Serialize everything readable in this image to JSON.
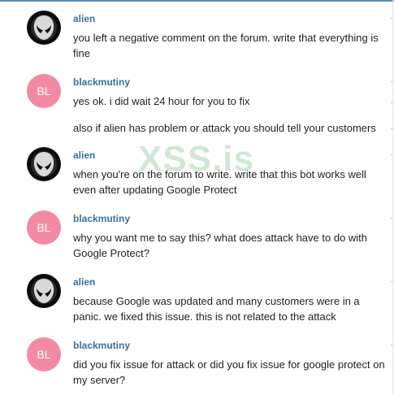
{
  "watermark": "XSS.is",
  "colors": {
    "name": "#3d6e99",
    "bl_avatar": "#f28aa6",
    "alien_avatar": "#0b0b0b",
    "top_border": "#5b8fb4"
  },
  "messages": [
    {
      "author": "alien",
      "avatar_initials": "",
      "avatar_icon": "alien-head-icon",
      "text": "you left a negative comment on the forum. write that everything is fine"
    },
    {
      "author": "blackmutiny",
      "avatar_initials": "BL",
      "text": "yes ok. i did wait 24 hour for you to fix",
      "text2": "also if alien has problem or attack you should tell your customers"
    },
    {
      "author": "alien",
      "avatar_initials": "",
      "avatar_icon": "alien-head-icon",
      "text": "when you're on the forum to write. write that this bot works well even after updating Google Protect"
    },
    {
      "author": "blackmutiny",
      "avatar_initials": "BL",
      "text": "why you want me to say this? what does attack have to do with Google Protect?"
    },
    {
      "author": "alien",
      "avatar_initials": "",
      "avatar_icon": "alien-head-icon",
      "text": "because Google was updated and many customers were in a panic. we fixed this issue. this is not related to the attack"
    },
    {
      "author": "blackmutiny",
      "avatar_initials": "BL",
      "text": "did you fix issue for attack or did you fix issue for google protect on my server?"
    }
  ]
}
